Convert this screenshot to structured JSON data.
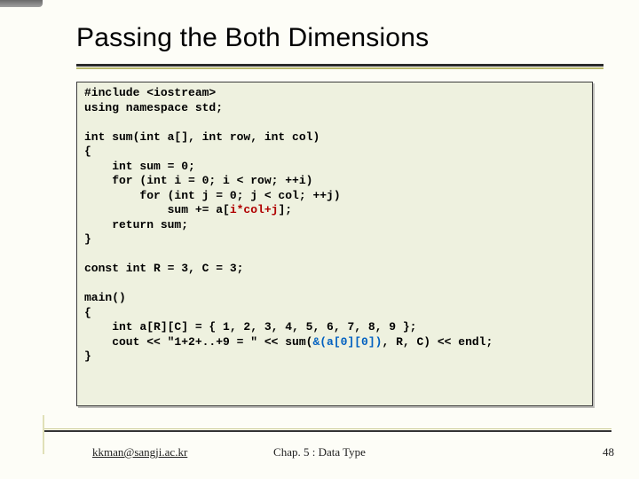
{
  "title": "Passing the Both Dimensions",
  "code": {
    "l01": "#include <iostream>",
    "l02": "using namespace std;",
    "l03": "",
    "l04": "int sum(int a[], int row, int col)",
    "l05": "{",
    "l06": "    int sum = 0;",
    "l07": "    for (int i = 0; i < row; ++i)",
    "l08": "        for (int j = 0; j < col; ++j)",
    "l09a": "            sum += a[",
    "l09b": "i*col+j",
    "l09c": "];",
    "l10": "    return sum;",
    "l11": "}",
    "l12": "",
    "l13": "const int R = 3, C = 3;",
    "l14": "",
    "l15": "main()",
    "l16": "{",
    "l17": "    int a[R][C] = { 1, 2, 3, 4, 5, 6, 7, 8, 9 };",
    "l18a": "    cout << \"1+2+..+9 = \" << sum(",
    "l18b": "&(a[0][0])",
    "l18c": ", R, C) << endl;",
    "l19": "}"
  },
  "footer": {
    "left": "kkman@sangji.ac.kr",
    "center": "Chap. 5 : Data Type",
    "right": "48"
  }
}
